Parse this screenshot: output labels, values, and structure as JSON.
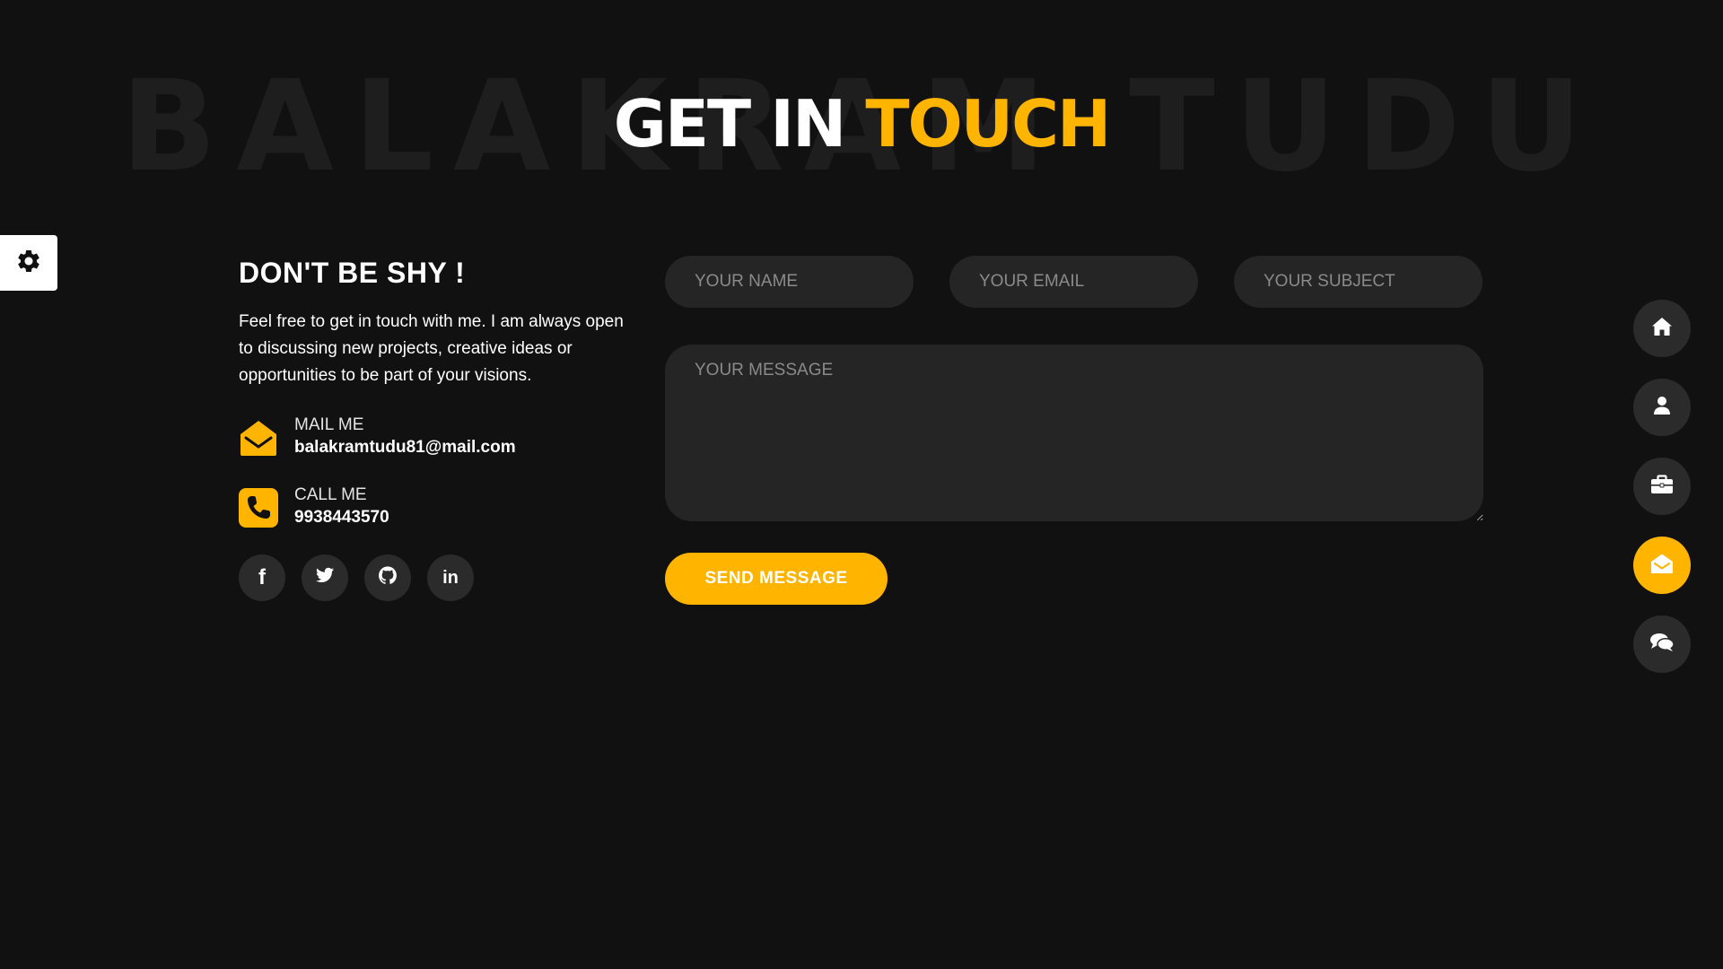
{
  "header": {
    "background_text": "BALAKRAM TUDU",
    "title_part1": "GET IN ",
    "title_part2": "TOUCH"
  },
  "settings": {
    "icon": "gear-icon"
  },
  "intro": {
    "heading": "DON'T BE SHY !",
    "description": "Feel free to get in touch with me. I am always open to discussing new projects, creative ideas or opportunities to be part of your visions."
  },
  "contacts": [
    {
      "icon": "envelope-open-icon",
      "label": "MAIL ME",
      "value": "balakramtudu81@mail.com"
    },
    {
      "icon": "phone-icon",
      "label": "CALL ME",
      "value": "9938443570"
    }
  ],
  "socials": [
    {
      "icon": "facebook-icon",
      "glyph": "f"
    },
    {
      "icon": "twitter-icon"
    },
    {
      "icon": "github-icon"
    },
    {
      "icon": "linkedin-icon",
      "glyph": "in"
    }
  ],
  "form": {
    "name_placeholder": "YOUR NAME",
    "email_placeholder": "YOUR EMAIL",
    "subject_placeholder": "YOUR SUBJECT",
    "message_placeholder": "YOUR MESSAGE",
    "submit_label": "SEND MESSAGE"
  },
  "nav": [
    {
      "icon": "home-icon",
      "active": false
    },
    {
      "icon": "user-icon",
      "active": false
    },
    {
      "icon": "briefcase-icon",
      "active": false
    },
    {
      "icon": "envelope-open-icon",
      "active": true
    },
    {
      "icon": "chat-icon",
      "active": false
    }
  ],
  "colors": {
    "background": "#111111",
    "accent": "#ffb400",
    "surface": "#252525"
  }
}
